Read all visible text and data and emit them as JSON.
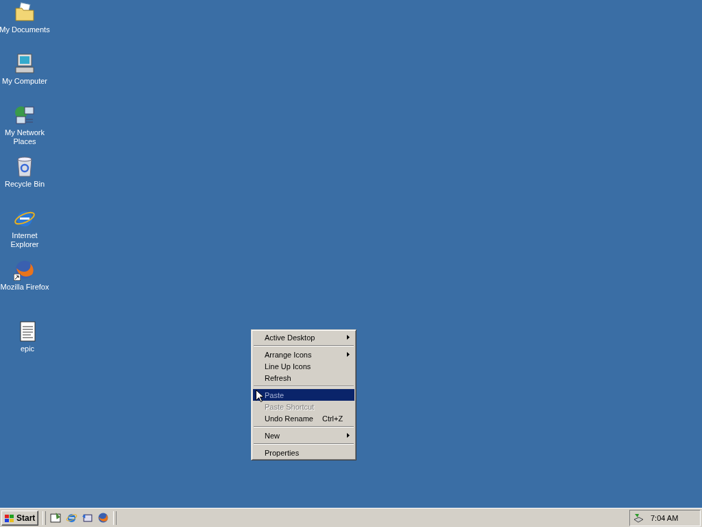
{
  "desktop_icons": [
    {
      "label": "My Documents",
      "kind": "folder",
      "shortcut": false
    },
    {
      "label": "My Computer",
      "kind": "computer",
      "shortcut": false
    },
    {
      "label": "My Network Places",
      "kind": "network",
      "shortcut": false
    },
    {
      "label": "Recycle Bin",
      "kind": "recycle",
      "shortcut": false
    },
    {
      "label": "Internet Explorer",
      "kind": "browser",
      "shortcut": false
    },
    {
      "label": "Mozilla Firefox",
      "kind": "fox",
      "shortcut": true
    },
    {
      "label": "epic",
      "kind": "notepad",
      "shortcut": false
    }
  ],
  "context_menu": [
    {
      "kind": "item",
      "label": "Active Desktop",
      "submenu": true,
      "disabled": false,
      "selected": false
    },
    {
      "kind": "separator"
    },
    {
      "kind": "item",
      "label": "Arrange Icons",
      "submenu": true,
      "disabled": false,
      "selected": false
    },
    {
      "kind": "item",
      "label": "Line Up Icons",
      "submenu": false,
      "disabled": false,
      "selected": false
    },
    {
      "kind": "item",
      "label": "Refresh",
      "submenu": false,
      "disabled": false,
      "selected": false
    },
    {
      "kind": "separator"
    },
    {
      "kind": "item",
      "label": "Paste",
      "submenu": false,
      "disabled": true,
      "selected": true
    },
    {
      "kind": "item",
      "label": "Paste Shortcut",
      "submenu": false,
      "disabled": true,
      "selected": false
    },
    {
      "kind": "item",
      "label": "Undo Rename",
      "shortcut": "Ctrl+Z",
      "submenu": false,
      "disabled": false,
      "selected": false
    },
    {
      "kind": "separator"
    },
    {
      "kind": "item",
      "label": "New",
      "submenu": true,
      "disabled": false,
      "selected": false
    },
    {
      "kind": "separator"
    },
    {
      "kind": "item",
      "label": "Properties",
      "submenu": false,
      "disabled": false,
      "selected": false
    }
  ],
  "taskbar": {
    "start_label": "Start",
    "quick_launch": [
      {
        "kind": "desktop"
      },
      {
        "kind": "browser"
      },
      {
        "kind": "channels"
      },
      {
        "kind": "fox"
      }
    ],
    "clock": "7:04 AM"
  }
}
